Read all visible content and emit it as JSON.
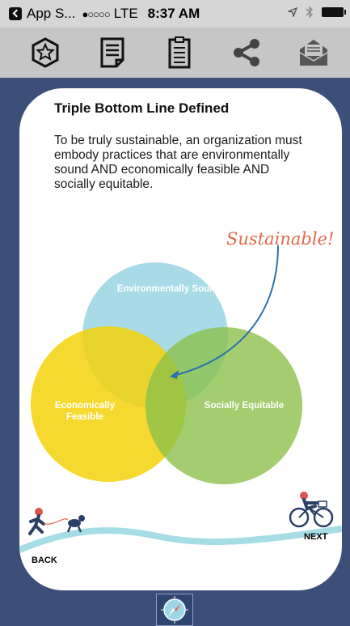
{
  "status_bar": {
    "back_app": "App S...",
    "signal": "●○○○○",
    "carrier": "LTE",
    "time": "8:37 AM"
  },
  "toolbar": {
    "items": [
      {
        "icon": "star-hexagon-icon"
      },
      {
        "icon": "document-icon"
      },
      {
        "icon": "clipboard-icon"
      },
      {
        "icon": "share-icon"
      },
      {
        "icon": "mail-icon"
      }
    ]
  },
  "card": {
    "title": "Triple Bottom Line Defined",
    "body": "To be truly sustainable, an organization must embody practices that are environmentally sound AND economically feasible AND socially equitable.",
    "sustainable_label": "Sustainable!",
    "circles": {
      "environmental": "Environmentally Sound",
      "economic": "Economically Feasible",
      "social": "Socially Equitable"
    },
    "colors": {
      "environmental": "#9fd6e6",
      "economic": "#f5d20a",
      "social": "#9bc85a",
      "accent": "#e3674c",
      "wave": "#a6dce6"
    },
    "back_label": "BACK",
    "next_label": "NEXT"
  },
  "bottom": {
    "icon": "compass-icon"
  }
}
